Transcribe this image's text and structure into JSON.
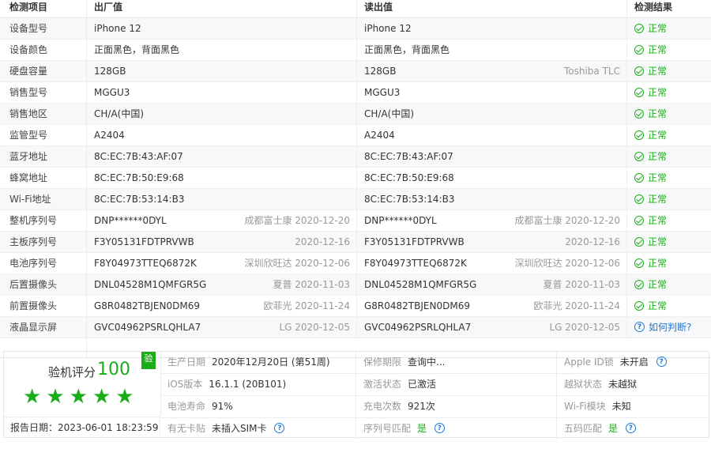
{
  "header": {
    "item": "检测项目",
    "factory": "出厂值",
    "read": "读出值",
    "result": "检测结果"
  },
  "rows": [
    {
      "item": "设备型号",
      "factory": "iPhone 12",
      "factory_meta": "",
      "read": "iPhone 12",
      "read_meta": "",
      "result": "正常",
      "result_type": "ok"
    },
    {
      "item": "设备颜色",
      "factory": "正面黑色，背面黑色",
      "factory_meta": "",
      "read": "正面黑色，背面黑色",
      "read_meta": "",
      "result": "正常",
      "result_type": "ok"
    },
    {
      "item": "硬盘容量",
      "factory": "128GB",
      "factory_meta": "",
      "read": "128GB",
      "read_meta": "Toshiba TLC",
      "result": "正常",
      "result_type": "ok"
    },
    {
      "item": "销售型号",
      "factory": "MGGU3",
      "factory_meta": "",
      "read": "MGGU3",
      "read_meta": "",
      "result": "正常",
      "result_type": "ok"
    },
    {
      "item": "销售地区",
      "factory": "CH/A(中国)",
      "factory_meta": "",
      "read": "CH/A(中国)",
      "read_meta": "",
      "result": "正常",
      "result_type": "ok"
    },
    {
      "item": "监管型号",
      "factory": "A2404",
      "factory_meta": "",
      "read": "A2404",
      "read_meta": "",
      "result": "正常",
      "result_type": "ok"
    },
    {
      "item": "蓝牙地址",
      "factory": "8C:EC:7B:43:AF:07",
      "factory_meta": "",
      "read": "8C:EC:7B:43:AF:07",
      "read_meta": "",
      "result": "正常",
      "result_type": "ok"
    },
    {
      "item": "蜂窝地址",
      "factory": "8C:EC:7B:50:E9:68",
      "factory_meta": "",
      "read": "8C:EC:7B:50:E9:68",
      "read_meta": "",
      "result": "正常",
      "result_type": "ok"
    },
    {
      "item": "Wi-Fi地址",
      "factory": "8C:EC:7B:53:14:B3",
      "factory_meta": "",
      "read": "8C:EC:7B:53:14:B3",
      "read_meta": "",
      "result": "正常",
      "result_type": "ok"
    },
    {
      "item": "整机序列号",
      "factory": "DNP******0DYL",
      "factory_meta": "成都富士康 2020-12-20",
      "read": "DNP******0DYL",
      "read_meta": "成都富士康 2020-12-20",
      "result": "正常",
      "result_type": "ok"
    },
    {
      "item": "主板序列号",
      "factory": "F3Y05131FDTPRVWB",
      "factory_meta": "2020-12-16",
      "read": "F3Y05131FDTPRVWB",
      "read_meta": "2020-12-16",
      "result": "正常",
      "result_type": "ok"
    },
    {
      "item": "电池序列号",
      "factory": "F8Y04973TTEQ6872K",
      "factory_meta": "深圳欣旺达 2020-12-06",
      "read": "F8Y04973TTEQ6872K",
      "read_meta": "深圳欣旺达 2020-12-06",
      "result": "正常",
      "result_type": "ok"
    },
    {
      "item": "后置摄像头",
      "factory": "DNL04528M1QMFGR5G",
      "factory_meta": "夏普 2020-11-03",
      "read": "DNL04528M1QMFGR5G",
      "read_meta": "夏普 2020-11-03",
      "result": "正常",
      "result_type": "ok"
    },
    {
      "item": "前置摄像头",
      "factory": "G8R0482TBJEN0DM69",
      "factory_meta": "欧菲光 2020-11-24",
      "read": "G8R0482TBJEN0DM69",
      "read_meta": "欧菲光 2020-11-24",
      "result": "正常",
      "result_type": "ok"
    },
    {
      "item": "液晶显示屏",
      "factory": "GVC04962PSRLQHLA7",
      "factory_meta": "LG 2020-12-05",
      "read": "GVC04962PSRLQHLA7",
      "read_meta": "LG 2020-12-05",
      "result": "如何判断?",
      "result_type": "help"
    }
  ],
  "summary": {
    "score_label": "验机评分",
    "score": "100",
    "badge": "验",
    "stars": 5,
    "star_char": "★",
    "report_date": "报告日期：2023-06-01 18:23:59",
    "grid": [
      [
        {
          "label": "生产日期",
          "value": "2020年12月20日 (第51周)",
          "help": false,
          "ok": false
        },
        {
          "label": "保修期限",
          "value": "查询中...",
          "help": false,
          "ok": false
        },
        {
          "label": "Apple ID锁",
          "value": "未开启",
          "help": true,
          "ok": false
        }
      ],
      [
        {
          "label": "iOS版本",
          "value": "16.1.1 (20B101)",
          "help": false,
          "ok": false
        },
        {
          "label": "激活状态",
          "value": "已激活",
          "help": false,
          "ok": false
        },
        {
          "label": "越狱状态",
          "value": "未越狱",
          "help": false,
          "ok": false
        }
      ],
      [
        {
          "label": "电池寿命",
          "value": "91%",
          "help": false,
          "ok": false
        },
        {
          "label": "充电次数",
          "value": "921次",
          "help": false,
          "ok": false
        },
        {
          "label": "Wi-Fi模块",
          "value": "未知",
          "help": false,
          "ok": false
        }
      ],
      [
        {
          "label": "有无卡贴",
          "value": "未插入SIM卡",
          "help": true,
          "ok": false
        },
        {
          "label": "序列号匹配",
          "value": "是",
          "help": true,
          "ok": true
        },
        {
          "label": "五码匹配",
          "value": "是",
          "help": true,
          "ok": true
        }
      ]
    ]
  },
  "icons": {
    "ok": "check-circle-icon",
    "help": "question-circle-icon"
  },
  "colors": {
    "ok": "#1aad19",
    "help": "#1e78d7",
    "muted": "#999999"
  }
}
